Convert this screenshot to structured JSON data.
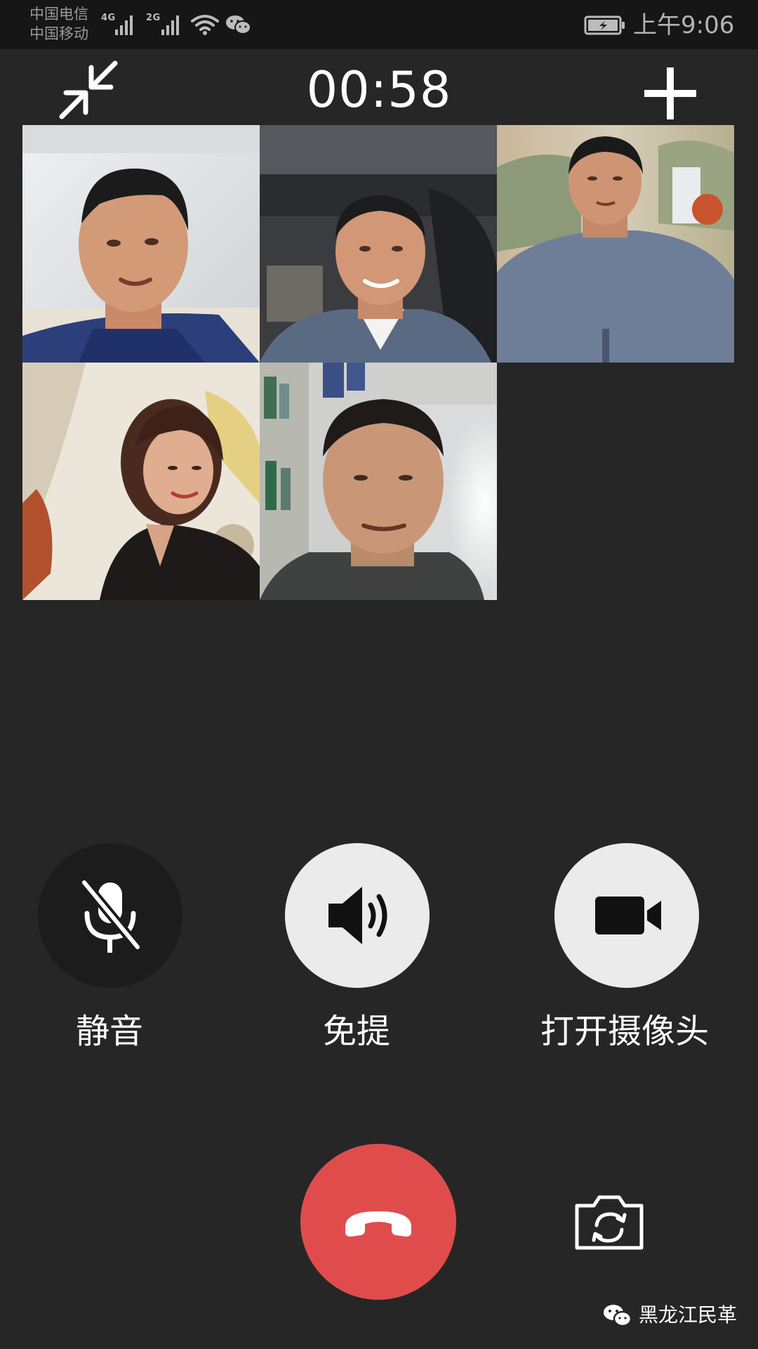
{
  "status_bar": {
    "carrier_1": "中国电信",
    "carrier_2": "中国移动",
    "network_1": "4G",
    "network_2": "2G",
    "icons": [
      "signal-strength-icon",
      "signal-strength-icon",
      "wifi-icon",
      "wechat-icon",
      "battery-charging-icon"
    ],
    "time": "上午9:06"
  },
  "call": {
    "timer": "00:58",
    "minimize_icon": "minimize-arrows-icon",
    "add_icon": "plus-icon",
    "participants": [
      {
        "name": "participant-1"
      },
      {
        "name": "participant-2"
      },
      {
        "name": "participant-3"
      },
      {
        "name": "participant-4"
      },
      {
        "name": "participant-5"
      }
    ]
  },
  "controls": {
    "mute": {
      "label": "静音",
      "icon": "muted-microphone-icon",
      "active": true
    },
    "speaker": {
      "label": "免提",
      "icon": "speaker-icon",
      "active": false
    },
    "camera": {
      "label": "打开摄像头",
      "icon": "video-camera-icon",
      "active": false
    },
    "hangup": {
      "icon": "hang-up-phone-icon"
    },
    "switch_camera": {
      "icon": "switch-camera-icon"
    }
  },
  "watermark": {
    "text": "黑龙江民革",
    "icon": "wechat-icon"
  },
  "colors": {
    "background": "#262626",
    "status_bar": "#161616",
    "hangup": "#e04c4c",
    "button_light": "#ebebeb",
    "button_dark": "#1c1c1c"
  }
}
